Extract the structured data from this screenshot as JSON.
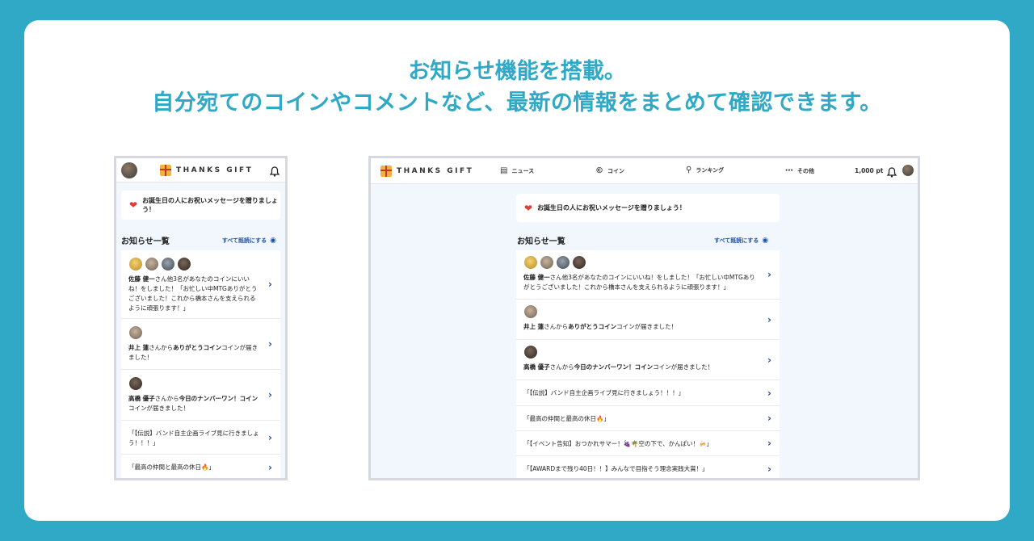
{
  "headline": {
    "line1": "お知らせ機能を搭載。",
    "line2": "自分宛てのコインやコメントなど、最新の情報をまとめて確認できます。"
  },
  "brand": "THANKS GIFT",
  "banner": "お誕生日の人にお祝いメッセージを贈りましょう！",
  "section_title": "お知らせ一覧",
  "mark_all_read": "すべて既読にする",
  "nav": {
    "news": "ニュース",
    "coin": "コイン",
    "ranking": "ランキング",
    "other": "その他",
    "points": "1,000 pt"
  },
  "icons": {
    "gift": "gift-icon",
    "bell": "bell-icon",
    "eye": "eye-icon",
    "heart": "heart-icon",
    "news": "newspaper-icon",
    "coin": "coin-icon",
    "ranking": "ranking-icon",
    "more": "more-icon",
    "chevron": "chevron-right-icon"
  },
  "notifications": {
    "n1": {
      "name": "佐藤 健一",
      "rest_mobile_1": "さん他3名があなたのコインにいいね！をしました！「お忙しい中MTGありがとうございました！これから橋本さんを支えられるように頑張ります！」",
      "rest_desktop": "さん他3名があなたのコインにいいね！をしました！「お忙しい中MTGありがとうございました！これから橋本さんを支えられるように頑張ります！」"
    },
    "n2": {
      "name": "井上 蓮",
      "mid": "さんから",
      "coin": "ありがとうコイン",
      "tail": "コインが届きました！"
    },
    "n3": {
      "name": "高橋 優子",
      "mid": "さんから",
      "coin": "今日のナンバーワン！コイン",
      "tail": "コインが届きました！"
    },
    "n4": "「【伝説】バンド自主企画ライブ見に行きましょう！！！」",
    "n5": "「最高の仲間と最高の休日🔥」",
    "n6": "「【イベント告知】おつかれサマー！🍇🌴空の下で、かんぱい！🍻」",
    "n7": "「【AWARDまで残り40日！！】みんなで目指そう理念実践大賞！」"
  }
}
